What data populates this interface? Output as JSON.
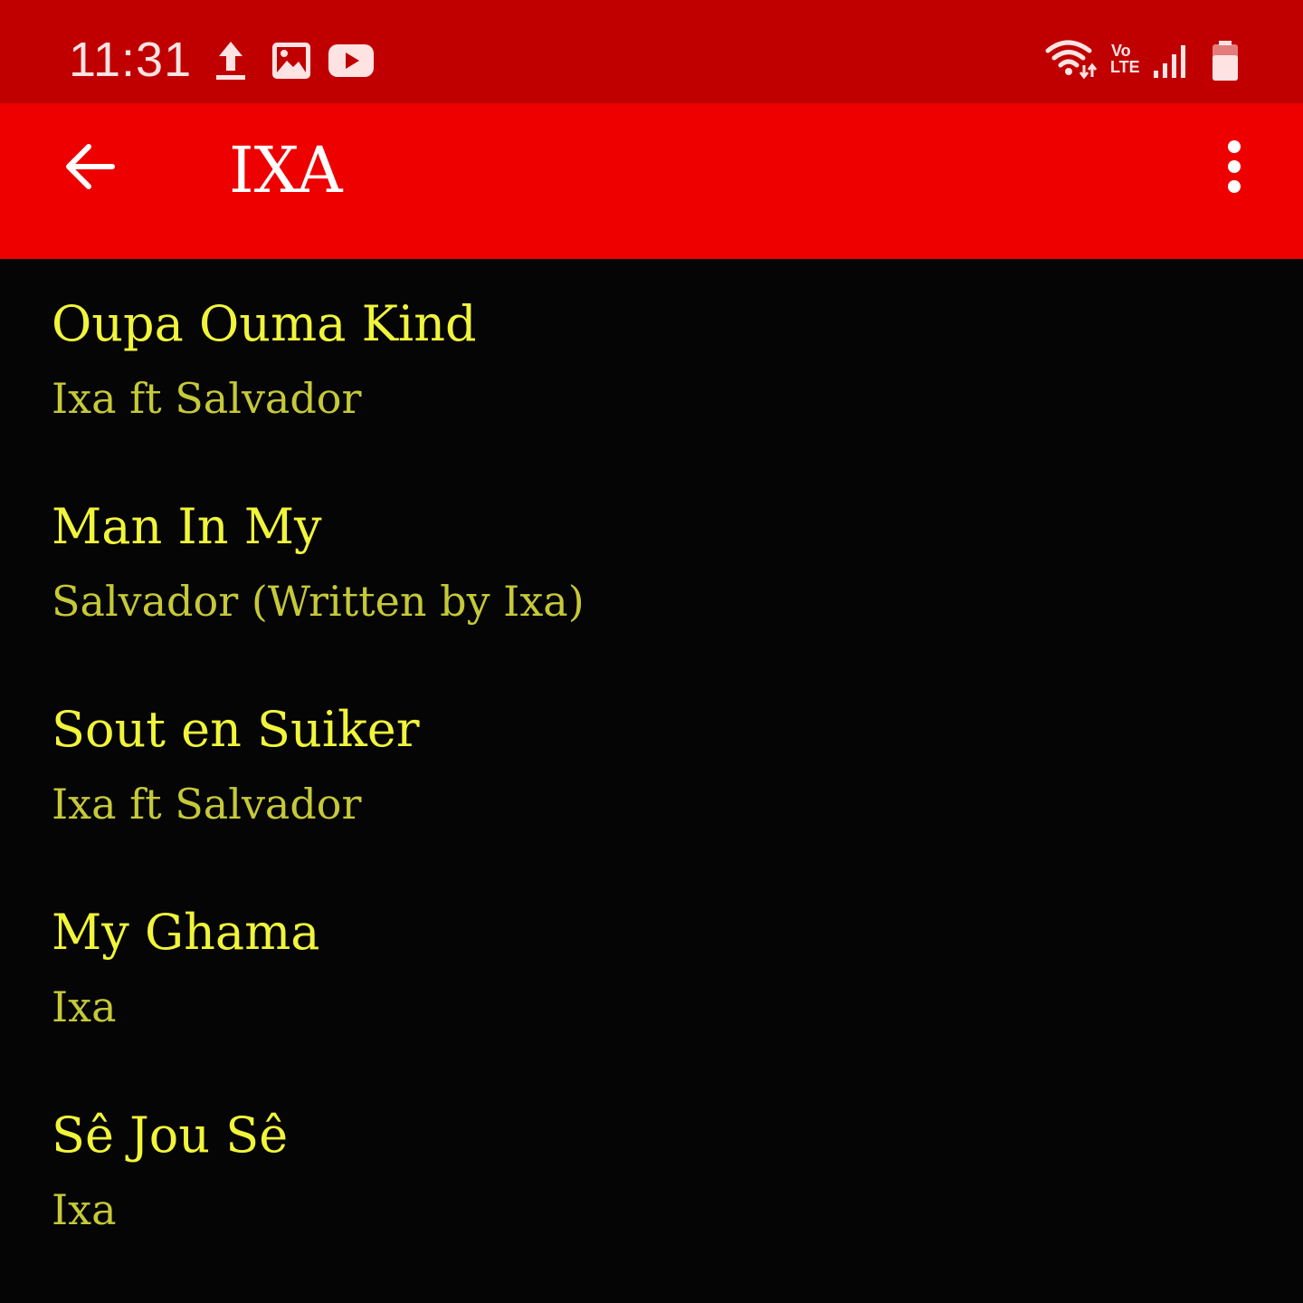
{
  "status_bar": {
    "time": "11:31",
    "left_icons": [
      "upload-icon",
      "image-icon",
      "youtube-icon"
    ],
    "right_icons": [
      "wifi-icon",
      "volte-icon",
      "signal-icon",
      "battery-icon"
    ],
    "volte_label_top": "Vo",
    "volte_label_bottom": "LTE"
  },
  "app_bar": {
    "title": "IXA",
    "back_icon": "arrow-back-icon",
    "menu_icon": "more-vert-icon"
  },
  "songs": [
    {
      "title": "Oupa Ouma Kind",
      "artist": "Ixa ft Salvador"
    },
    {
      "title": "Man In My",
      "artist": "Salvador (Written by Ixa)"
    },
    {
      "title": "Sout en Suiker",
      "artist": "Ixa ft Salvador"
    },
    {
      "title": "My Ghama",
      "artist": "Ixa"
    },
    {
      "title": "Sê Jou Sê",
      "artist": "Ixa"
    }
  ],
  "colors": {
    "status_bar": "#c00000",
    "app_bar": "#ee0000",
    "background": "#050505",
    "title_text": "#f1f53a",
    "artist_text": "#c6c938"
  }
}
